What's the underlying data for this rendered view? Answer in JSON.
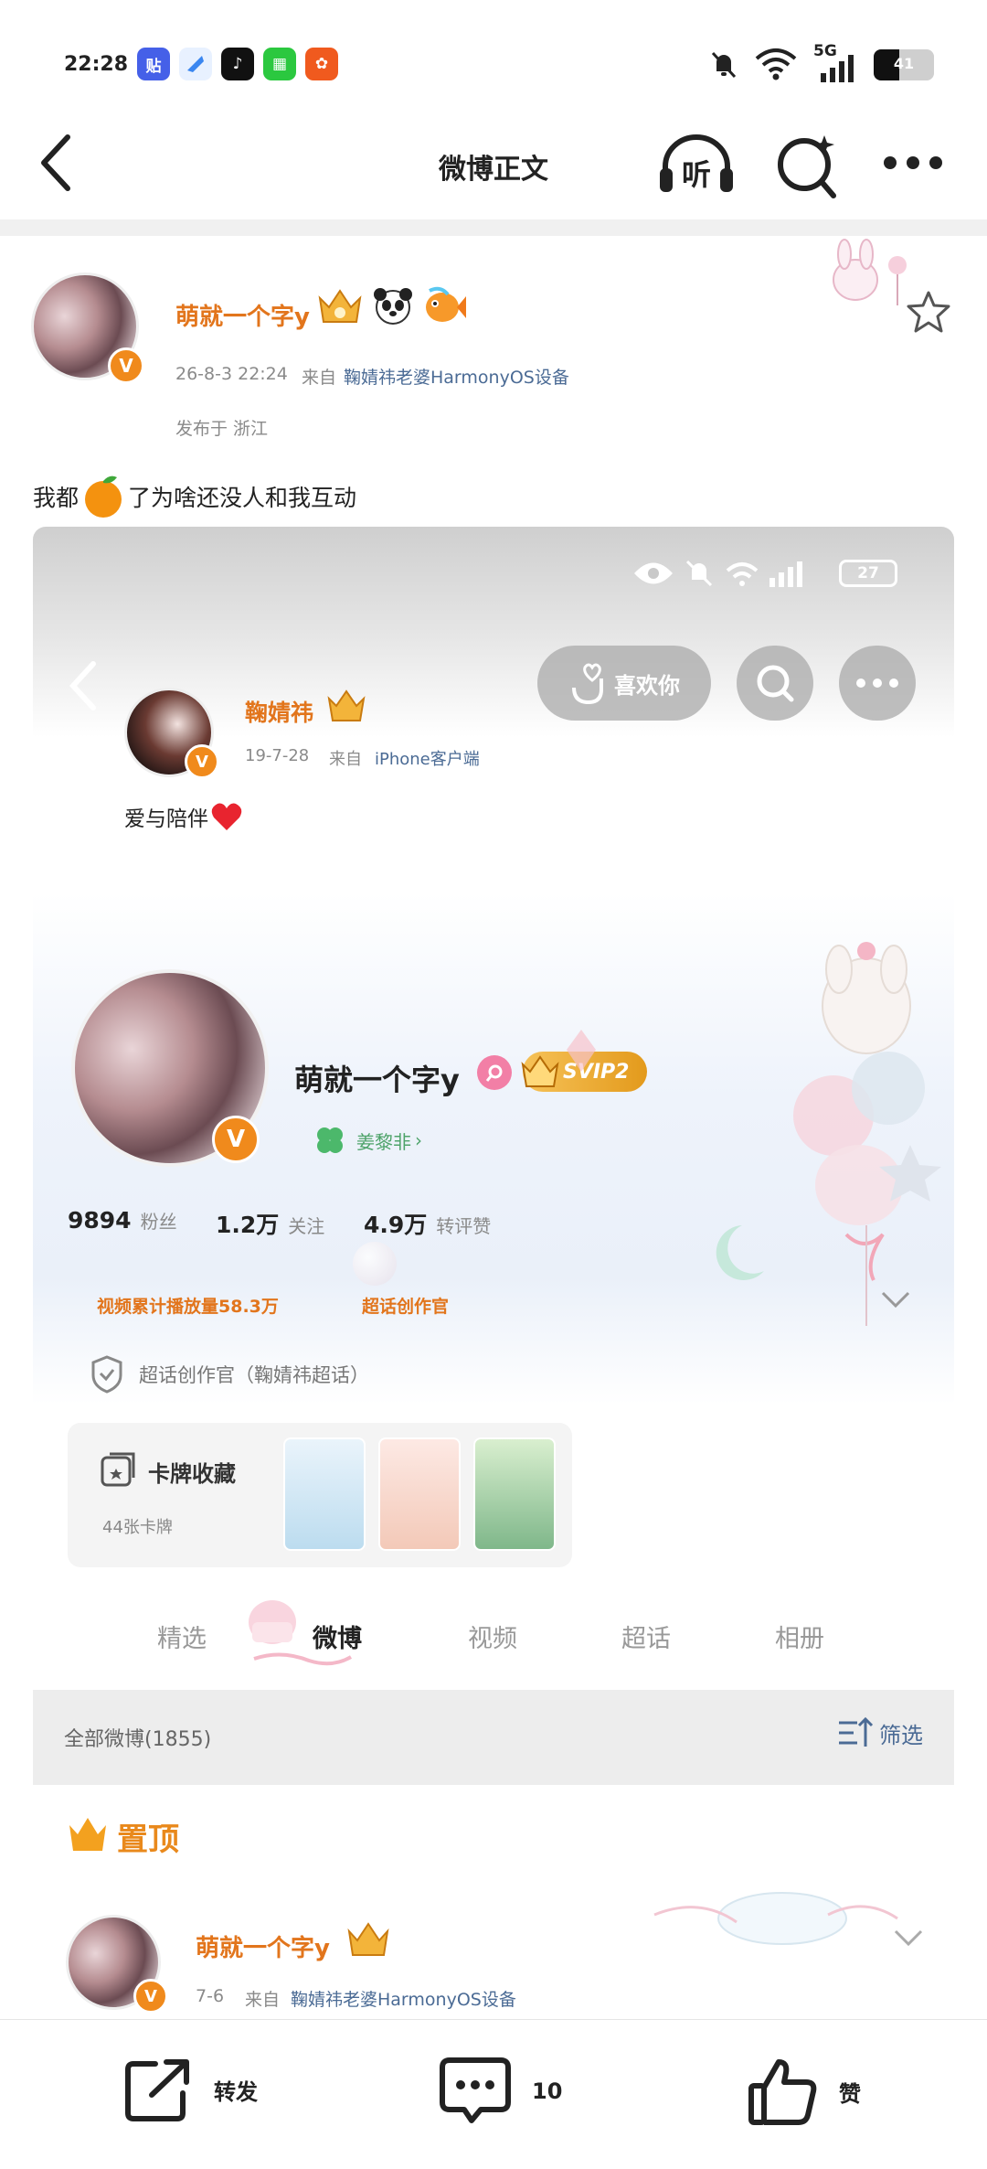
{
  "status_bar": {
    "time": "22:28",
    "apps": [
      {
        "name": "tieba",
        "glyph": "贴",
        "color": "#4560e8"
      },
      {
        "name": "browser",
        "glyph": "",
        "color": "#4a8ff0"
      },
      {
        "name": "douyin",
        "glyph": "♪",
        "color": "#111111"
      },
      {
        "name": "green-app",
        "glyph": "▦",
        "color": "#2bc83f"
      },
      {
        "name": "orange-app",
        "glyph": "✿",
        "color": "#f05a1e"
      }
    ],
    "network": "5G",
    "battery": "41"
  },
  "nav": {
    "title": "微博正文",
    "listen_label": "听"
  },
  "post": {
    "username": "萌就一个字y",
    "date": "26-8-3 22:24",
    "source_prefix": "来自",
    "source": "鞠婧祎老婆HarmonyOS设备",
    "location": "发布于 浙江",
    "text_before": "我都",
    "text_after": "了为啥还没人和我互动"
  },
  "embedded": {
    "status_battery": "27",
    "like_you_label": "喜欢你",
    "quoted_user": {
      "name": "鞠婧祎",
      "date": "19-7-28",
      "source_prefix": "来自",
      "source": "iPhone客户端",
      "text": "爱与陪伴"
    },
    "profile": {
      "name": "萌就一个字y",
      "svip": "SVIP2",
      "fan_tag": "姜黎非",
      "stats": [
        {
          "value": "9894",
          "label": "粉丝"
        },
        {
          "value": "1.2万",
          "label": "关注"
        },
        {
          "value": "4.9万",
          "label": "转评赞"
        }
      ],
      "badges": [
        "视频累计播放量58.3万",
        "超话创作官"
      ],
      "creator_line": "超话创作官（鞠婧祎超话）",
      "cards_title": "卡牌收藏",
      "cards_count": "44张卡牌"
    },
    "tabs": [
      "精选",
      "微博",
      "视频",
      "超话",
      "相册"
    ],
    "active_tab": "微博",
    "all_weibo": "全部微博(1855)",
    "filter_label": "筛选",
    "pinned_label": "置顶",
    "pinned_post": {
      "username": "萌就一个字y",
      "date": "7-6",
      "source_prefix": "来自",
      "source": "鞠婧祎老婆HarmonyOS设备"
    }
  },
  "actions": {
    "repost": "转发",
    "comment_count": "10",
    "like": "赞"
  },
  "colors": {
    "orange": "#e2751c",
    "link_blue": "#4b6b95",
    "v_badge": "#f08a1c"
  }
}
